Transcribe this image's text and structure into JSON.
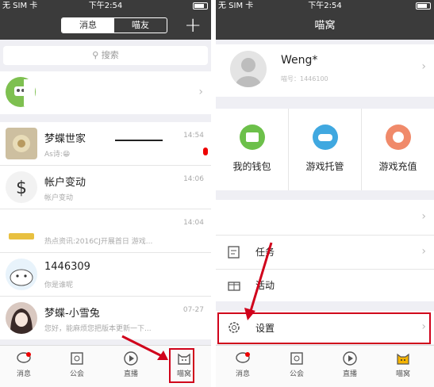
{
  "status": {
    "carrier": "无 SIM 卡",
    "time": "下午2:54"
  },
  "left": {
    "tabs": [
      {
        "label": "消息"
      },
      {
        "label": "喵友"
      }
    ],
    "search_placeholder": "搜索",
    "conversations": [
      {
        "title": "梦蝶世家",
        "subtitle": "As诗:😁",
        "time": "14:54"
      },
      {
        "title": "帐户变动",
        "subtitle": "帐户变动",
        "time": "14:06"
      },
      {
        "title": "",
        "subtitle": "热点资讯:2016CJ开展首日 游戏...",
        "time": "14:04"
      },
      {
        "title": "1446309",
        "subtitle": "你是谁呢",
        "time": ""
      },
      {
        "title": "梦蝶-小雪兔",
        "subtitle": "您好，能麻烦您把版本更新一下...",
        "time": "07-27"
      }
    ]
  },
  "right": {
    "title": "喵窝",
    "profile": {
      "name": "Weng*",
      "id_text": "喵号：1446100"
    },
    "grid": [
      {
        "label": "我的钱包"
      },
      {
        "label": "游戏托管"
      },
      {
        "label": "游戏充值"
      }
    ],
    "menu": [
      {
        "label": ""
      },
      {
        "label": "任务"
      },
      {
        "label": "活动"
      },
      {
        "label": "设置"
      }
    ]
  },
  "tabbar": [
    {
      "label": "消息"
    },
    {
      "label": "公会"
    },
    {
      "label": "直播"
    },
    {
      "label": "喵窝"
    }
  ],
  "colors": {
    "accent": "#f5b400",
    "highlight": "#d0021b",
    "nav": "#3b3b3b"
  }
}
